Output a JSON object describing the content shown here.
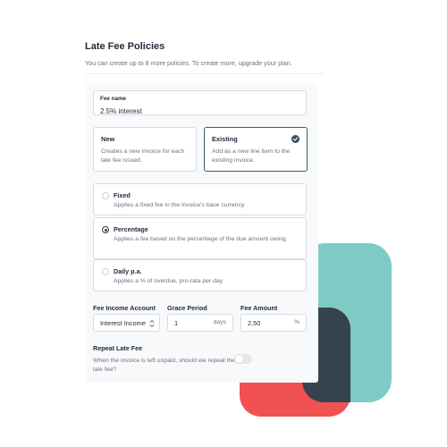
{
  "colors": {
    "teal": "#7ecbc5",
    "red": "#f15152",
    "dark": "#36434d",
    "selected_border": "#3d5a6c"
  },
  "header": {
    "title": "Late Fee Policies",
    "subtitle": "You can create up to 8 more policies. To create more, upgrade your plan."
  },
  "fee_name": {
    "label": "Fee name",
    "value": "2.5% interest"
  },
  "invoice_options": [
    {
      "title": "New",
      "description": "Creates a new invoice for each late fee issued.",
      "selected": false
    },
    {
      "title": "Existing",
      "description": "Add as a new line item to the existing invoice.",
      "selected": true
    }
  ],
  "fee_types": [
    {
      "title": "Fixed",
      "description": "Applies a fixed fee in the invoice's base currency",
      "selected": false
    },
    {
      "title": "Percentage",
      "description": "Applies a fee based on the percentage of the due amount owing",
      "selected": true
    },
    {
      "title": "Daily p.a.",
      "description": "Applies a % of overdue, pro-rata per day",
      "selected": false
    }
  ],
  "settings": {
    "income_account": {
      "label": "Fee Income Account",
      "value": "Interest Income"
    },
    "grace_period": {
      "label": "Grace Period",
      "value": "1",
      "unit": "days"
    },
    "fee_amount": {
      "label": "Fee Amount",
      "value": "2.50",
      "unit": "%"
    }
  },
  "repeat": {
    "title": "Repeat Late Fee",
    "description": "When the invoice is left unpaid, should we repeat the late fee?",
    "enabled": false
  }
}
